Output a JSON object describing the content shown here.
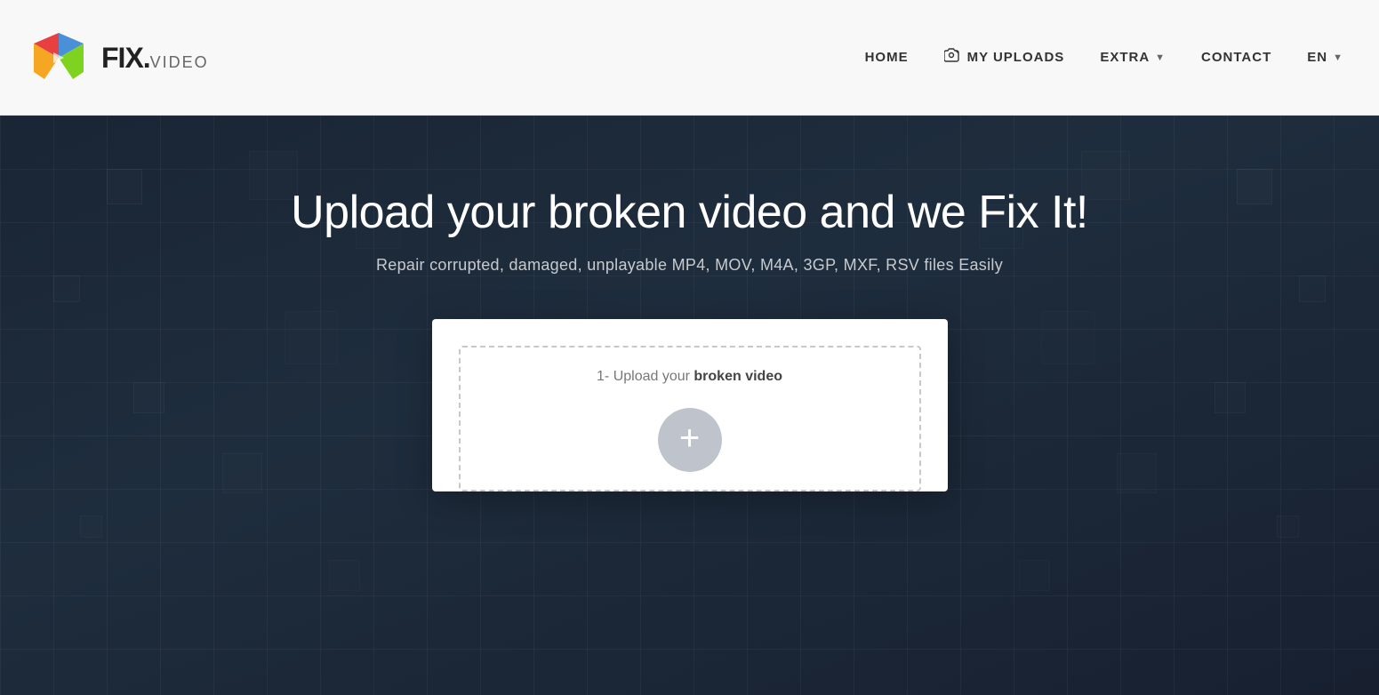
{
  "header": {
    "logo_text": "FIX.",
    "logo_suffix": "VIDEO",
    "nav": [
      {
        "id": "home",
        "label": "HOME",
        "has_icon": false,
        "has_arrow": false
      },
      {
        "id": "my-uploads",
        "label": "MY UPLOADS",
        "has_icon": true,
        "has_arrow": false
      },
      {
        "id": "extra",
        "label": "EXTRA",
        "has_icon": false,
        "has_arrow": true
      },
      {
        "id": "contact",
        "label": "CONTACT",
        "has_icon": false,
        "has_arrow": false
      },
      {
        "id": "lang",
        "label": "EN",
        "has_icon": false,
        "has_arrow": true
      }
    ]
  },
  "hero": {
    "title": "Upload your broken video and we Fix It!",
    "subtitle": "Repair corrupted, damaged, unplayable MP4, MOV, M4A, 3GP, MXF, RSV files Easily"
  },
  "upload_card": {
    "zone_label_prefix": "1- Upload your ",
    "zone_label_bold": "broken video",
    "plus_icon": "+"
  }
}
